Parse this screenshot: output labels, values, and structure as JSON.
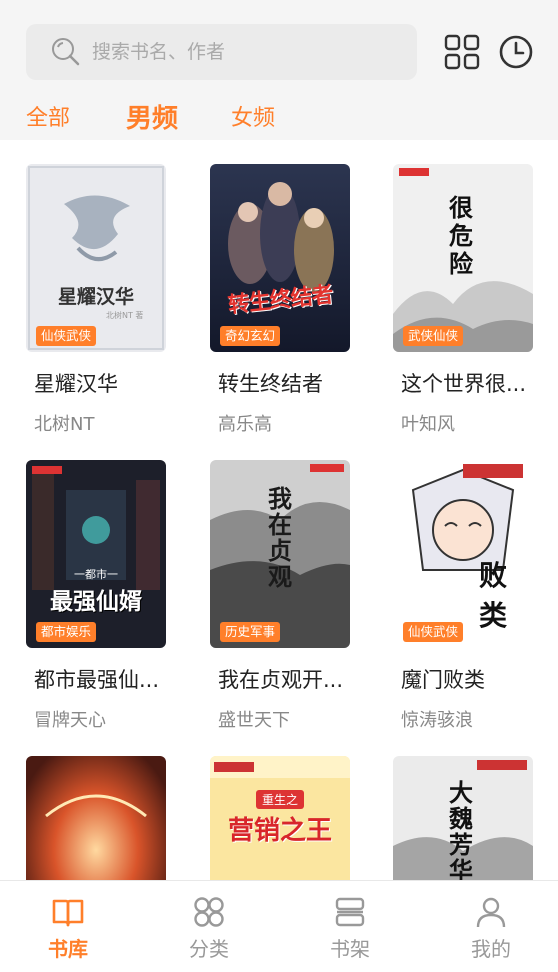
{
  "search": {
    "placeholder": "搜索书名、作者"
  },
  "header_icons": [
    "grid-apps-icon",
    "history-clock-icon"
  ],
  "tabs": [
    {
      "label": "全部",
      "active": false
    },
    {
      "label": "男频",
      "active": true
    },
    {
      "label": "女频",
      "active": false
    }
  ],
  "books": [
    {
      "title": "星耀汉华",
      "author": "北树NT",
      "badge": "仙侠武侠",
      "cover_text": "星耀汉华",
      "cover_small": "北树NT 著"
    },
    {
      "title": "转生终结者",
      "author": "高乐高",
      "badge": "奇幻玄幻",
      "cover_text": "转生终结者",
      "cover_small": ""
    },
    {
      "title": "这个世界很...",
      "author": "叶知风",
      "badge": "武侠仙侠",
      "cover_text": "很危险",
      "cover_small": ""
    },
    {
      "title": "都市最强仙...",
      "author": "冒牌天心",
      "badge": "都市娱乐",
      "cover_text": "最强仙婿",
      "cover_small": "一都市一"
    },
    {
      "title": "我在贞观开...",
      "author": "盛世天下",
      "badge": "历史军事",
      "cover_text": "我在贞观",
      "cover_small": ""
    },
    {
      "title": "魔门败类",
      "author": "惊涛骇浪",
      "badge": "仙侠武侠",
      "cover_text": "败类",
      "cover_small": ""
    },
    {
      "title": "",
      "author": "",
      "badge": "",
      "cover_text": "",
      "cover_small": ""
    },
    {
      "title": "",
      "author": "",
      "badge": "",
      "cover_text": "营销之王",
      "cover_small": "重生之"
    },
    {
      "title": "",
      "author": "",
      "badge": "",
      "cover_text": "大魏芳华",
      "cover_small": ""
    }
  ],
  "nav": [
    {
      "label": "书库",
      "icon": "book-open-icon",
      "active": true
    },
    {
      "label": "分类",
      "icon": "category-icon",
      "active": false
    },
    {
      "label": "书架",
      "icon": "bookshelf-icon",
      "active": false
    },
    {
      "label": "我的",
      "icon": "user-icon",
      "active": false
    }
  ],
  "colors": {
    "accent": "#ff7f2a",
    "header_bg": "#f5f5f5",
    "search_bg": "#ebebeb"
  }
}
